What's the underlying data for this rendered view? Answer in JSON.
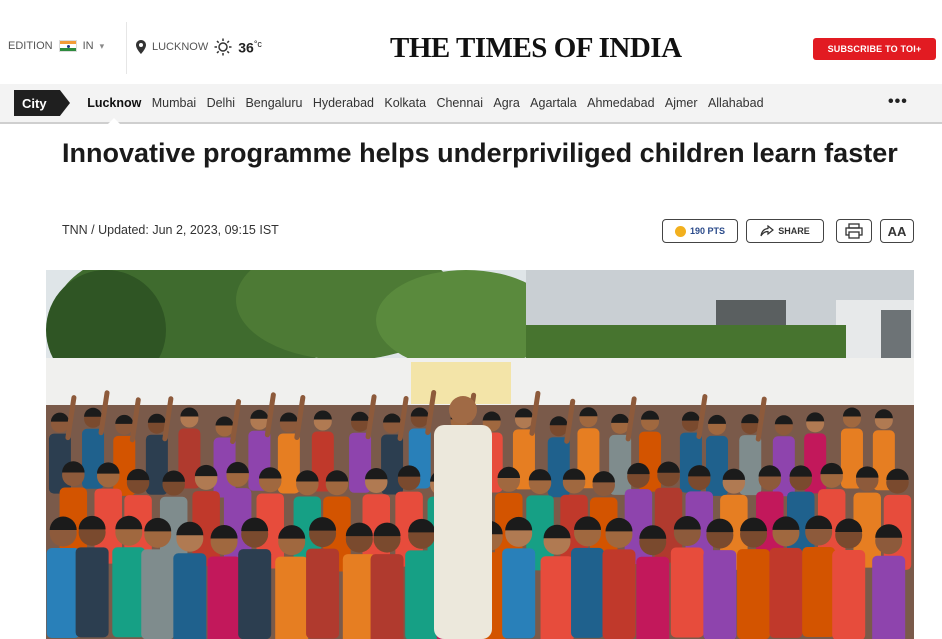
{
  "header": {
    "edition_label": "EDITION",
    "edition_value": "IN",
    "location": "LUCKNOW",
    "temperature": "36",
    "temperature_unit": "°c",
    "logo": "THE TIMES OF INDIA",
    "subscribe_label": "SUBSCRIBE TO TOI+"
  },
  "nav": {
    "city_tag": "City",
    "items": [
      "Lucknow",
      "Mumbai",
      "Delhi",
      "Bengaluru",
      "Hyderabad",
      "Kolkata",
      "Chennai",
      "Agra",
      "Agartala",
      "Ahmedabad",
      "Ajmer",
      "Allahabad"
    ],
    "active": "Lucknow",
    "more": "•••"
  },
  "article": {
    "headline": "Innovative programme helps underpriviliged children learn faster",
    "byline": "TNN / Updated: Jun 2, 2023, 09:15 IST",
    "points_label": "190 PTS",
    "share_label": "SHARE",
    "font_size_label": "AA"
  },
  "colors": {
    "brand_red": "#e21b22",
    "nav_bg": "#f3f3f3",
    "city_tag_bg": "#1f1f1f"
  },
  "icons": {
    "location": "pin-icon",
    "weather": "sun-icon",
    "points": "coin-icon",
    "share": "share-arrow-icon",
    "print": "printer-icon",
    "more": "more-dots-icon"
  }
}
